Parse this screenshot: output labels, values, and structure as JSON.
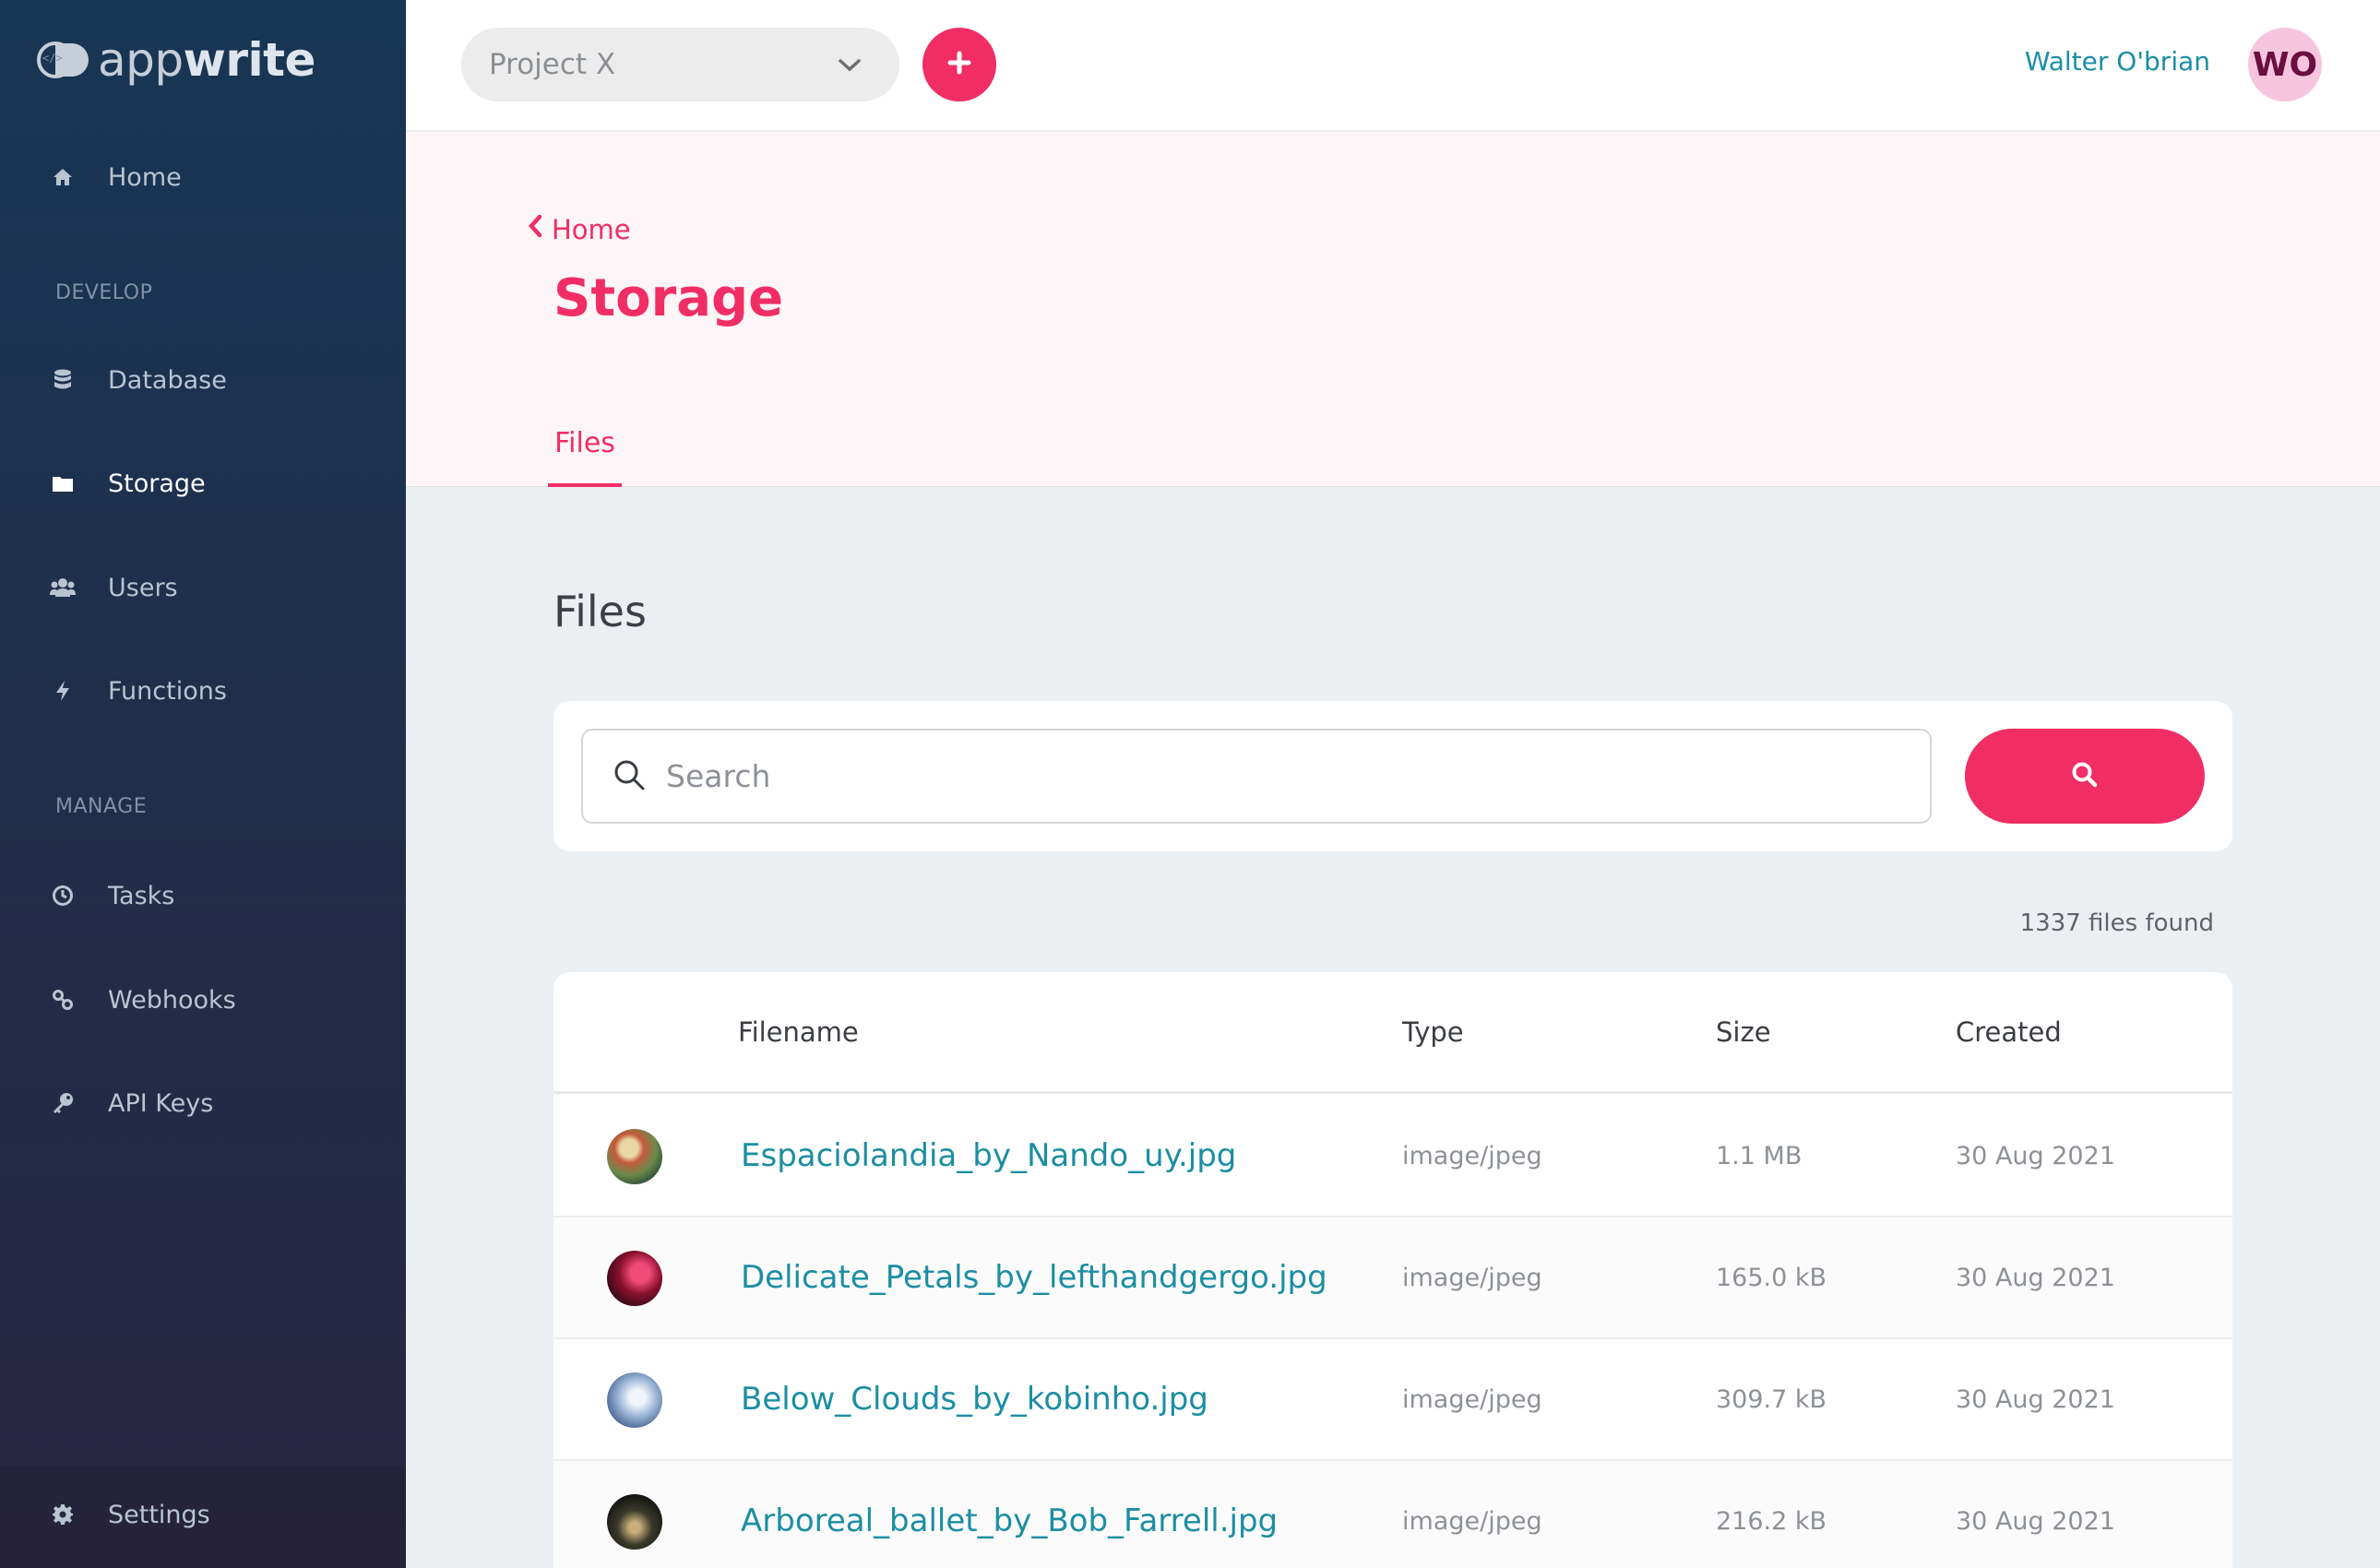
{
  "app": {
    "logo_text_light": "app",
    "logo_text_bold": "write",
    "logo_mark_glyph": "</>"
  },
  "sidebar": {
    "home": {
      "label": "Home",
      "icon": "home-icon"
    },
    "sections": {
      "develop": "DEVELOP",
      "manage": "MANAGE"
    },
    "develop_items": [
      {
        "label": "Database",
        "icon": "database-icon"
      },
      {
        "label": "Storage",
        "icon": "folder-icon",
        "active": true
      },
      {
        "label": "Users",
        "icon": "users-icon"
      },
      {
        "label": "Functions",
        "icon": "bolt-icon"
      }
    ],
    "manage_items": [
      {
        "label": "Tasks",
        "icon": "clock-icon"
      },
      {
        "label": "Webhooks",
        "icon": "webhook-icon"
      },
      {
        "label": "API Keys",
        "icon": "key-icon"
      }
    ],
    "settings": {
      "label": "Settings",
      "icon": "gear-icon"
    }
  },
  "topbar": {
    "project": "Project X",
    "user_name": "Walter O'brian",
    "avatar_initials": "WO"
  },
  "header": {
    "back_label": "Home",
    "title": "Storage",
    "tabs": [
      {
        "label": "Files",
        "active": true
      }
    ]
  },
  "main": {
    "section_title": "Files",
    "search_placeholder": "Search",
    "count_text": "1337 files found",
    "columns": {
      "filename": "Filename",
      "type": "Type",
      "size": "Size",
      "created": "Created"
    },
    "rows": [
      {
        "filename": "Espaciolandia_by_Nando_uy.jpg",
        "type": "image/jpeg",
        "size": "1.1 MB",
        "created": "30 Aug 2021"
      },
      {
        "filename": "Delicate_Petals_by_lefthandgergo.jpg",
        "type": "image/jpeg",
        "size": "165.0 kB",
        "created": "30 Aug 2021"
      },
      {
        "filename": "Below_Clouds_by_kobinho.jpg",
        "type": "image/jpeg",
        "size": "309.7 kB",
        "created": "30 Aug 2021"
      },
      {
        "filename": "Arboreal_ballet_by_Bob_Farrell.jpg",
        "type": "image/jpeg",
        "size": "216.2 kB",
        "created": "30 Aug 2021"
      }
    ]
  },
  "colors": {
    "accent": "#f02e65",
    "link": "#1b8ea3",
    "sidebar_top": "#173654",
    "sidebar_bottom": "#2a2540"
  }
}
